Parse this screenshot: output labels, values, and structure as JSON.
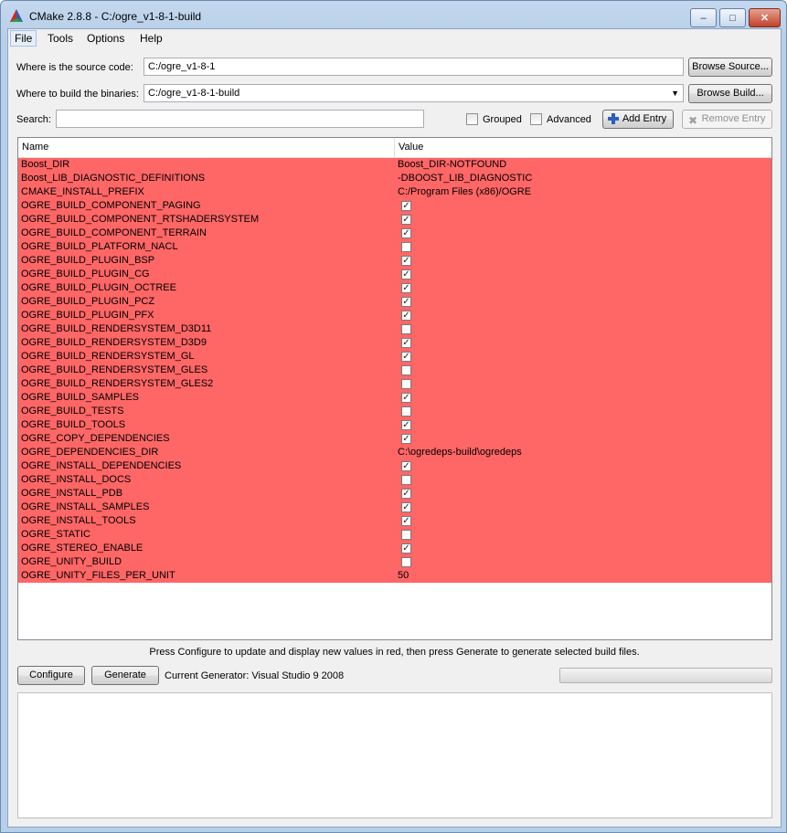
{
  "window": {
    "title": "CMake 2.8.8 - C:/ogre_v1-8-1-build",
    "controls": {
      "minimize": "–",
      "maximize": "□",
      "close": "✕"
    }
  },
  "menu": [
    {
      "label": "File"
    },
    {
      "label": "Tools"
    },
    {
      "label": "Options"
    },
    {
      "label": "Help"
    }
  ],
  "source": {
    "label": "Where is the source code:",
    "value": "C:/ogre_v1-8-1",
    "button": "Browse Source..."
  },
  "binaries": {
    "label": "Where to build the binaries:",
    "value": "C:/ogre_v1-8-1-build",
    "button": "Browse Build..."
  },
  "search": {
    "label": "Search:",
    "value": "",
    "grouped_label": "Grouped",
    "advanced_label": "Advanced",
    "add_entry": "Add Entry",
    "remove_entry": "Remove Entry"
  },
  "table": {
    "columns": [
      "Name",
      "Value"
    ],
    "rows": [
      {
        "name": "Boost_DIR",
        "type": "text",
        "value": "Boost_DIR-NOTFOUND"
      },
      {
        "name": "Boost_LIB_DIAGNOSTIC_DEFINITIONS",
        "type": "text",
        "value": "-DBOOST_LIB_DIAGNOSTIC"
      },
      {
        "name": "CMAKE_INSTALL_PREFIX",
        "type": "text",
        "value": "C:/Program Files (x86)/OGRE"
      },
      {
        "name": "OGRE_BUILD_COMPONENT_PAGING",
        "type": "bool",
        "checked": true
      },
      {
        "name": "OGRE_BUILD_COMPONENT_RTSHADERSYSTEM",
        "type": "bool",
        "checked": true
      },
      {
        "name": "OGRE_BUILD_COMPONENT_TERRAIN",
        "type": "bool",
        "checked": true
      },
      {
        "name": "OGRE_BUILD_PLATFORM_NACL",
        "type": "bool",
        "checked": false
      },
      {
        "name": "OGRE_BUILD_PLUGIN_BSP",
        "type": "bool",
        "checked": true
      },
      {
        "name": "OGRE_BUILD_PLUGIN_CG",
        "type": "bool",
        "checked": true
      },
      {
        "name": "OGRE_BUILD_PLUGIN_OCTREE",
        "type": "bool",
        "checked": true
      },
      {
        "name": "OGRE_BUILD_PLUGIN_PCZ",
        "type": "bool",
        "checked": true
      },
      {
        "name": "OGRE_BUILD_PLUGIN_PFX",
        "type": "bool",
        "checked": true
      },
      {
        "name": "OGRE_BUILD_RENDERSYSTEM_D3D11",
        "type": "bool",
        "checked": false
      },
      {
        "name": "OGRE_BUILD_RENDERSYSTEM_D3D9",
        "type": "bool",
        "checked": true
      },
      {
        "name": "OGRE_BUILD_RENDERSYSTEM_GL",
        "type": "bool",
        "checked": true
      },
      {
        "name": "OGRE_BUILD_RENDERSYSTEM_GLES",
        "type": "bool",
        "checked": false
      },
      {
        "name": "OGRE_BUILD_RENDERSYSTEM_GLES2",
        "type": "bool",
        "checked": false
      },
      {
        "name": "OGRE_BUILD_SAMPLES",
        "type": "bool",
        "checked": true
      },
      {
        "name": "OGRE_BUILD_TESTS",
        "type": "bool",
        "checked": false
      },
      {
        "name": "OGRE_BUILD_TOOLS",
        "type": "bool",
        "checked": true
      },
      {
        "name": "OGRE_COPY_DEPENDENCIES",
        "type": "bool",
        "checked": true
      },
      {
        "name": "OGRE_DEPENDENCIES_DIR",
        "type": "text",
        "value": "C:\\ogredeps-build\\ogredeps"
      },
      {
        "name": "OGRE_INSTALL_DEPENDENCIES",
        "type": "bool",
        "checked": true
      },
      {
        "name": "OGRE_INSTALL_DOCS",
        "type": "bool",
        "checked": false
      },
      {
        "name": "OGRE_INSTALL_PDB",
        "type": "bool",
        "checked": true
      },
      {
        "name": "OGRE_INSTALL_SAMPLES",
        "type": "bool",
        "checked": true
      },
      {
        "name": "OGRE_INSTALL_TOOLS",
        "type": "bool",
        "checked": true
      },
      {
        "name": "OGRE_STATIC",
        "type": "bool",
        "checked": false
      },
      {
        "name": "OGRE_STEREO_ENABLE",
        "type": "bool",
        "checked": true
      },
      {
        "name": "OGRE_UNITY_BUILD",
        "type": "bool",
        "checked": false
      },
      {
        "name": "OGRE_UNITY_FILES_PER_UNIT",
        "type": "text",
        "value": "50"
      }
    ]
  },
  "hint": "Press Configure to update and display new values in red, then press Generate to generate selected build files.",
  "actions": {
    "configure": "Configure",
    "generate": "Generate",
    "generator": "Current Generator: Visual Studio 9 2008"
  },
  "colors": {
    "changed_row": "#ff6666",
    "highlight_outline": "#000000"
  }
}
